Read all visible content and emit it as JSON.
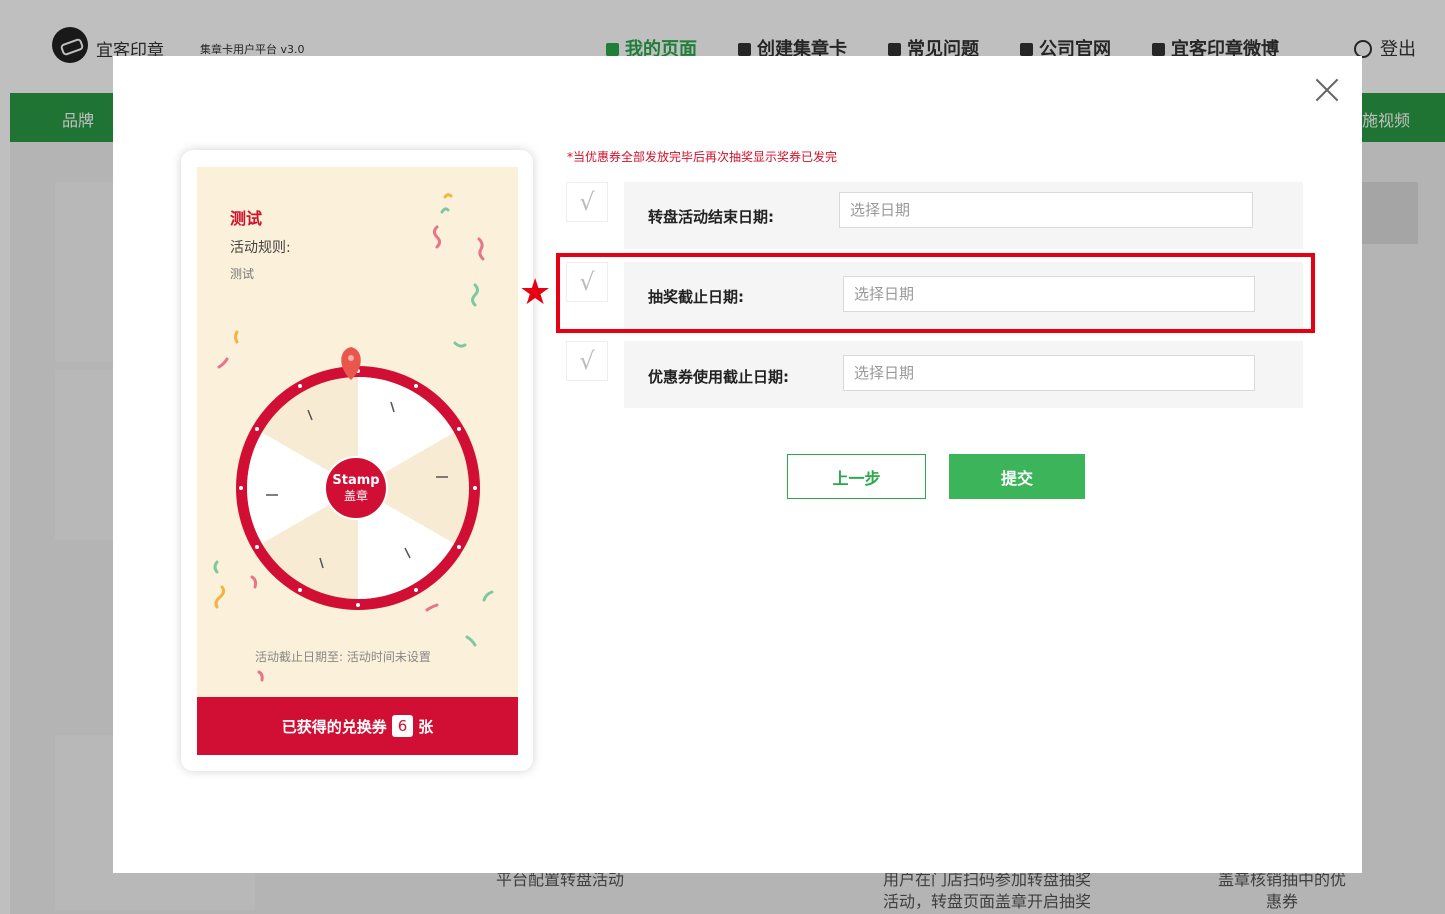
{
  "header": {
    "brand": "宜客印章",
    "subtitle": "集章卡用户平台 v3.0",
    "nav": [
      {
        "label": "我的页面"
      },
      {
        "label": "创建集章卡"
      },
      {
        "label": "常见问题"
      },
      {
        "label": "公司官网"
      },
      {
        "label": "宜客印章微博"
      }
    ],
    "logout": "登出"
  },
  "green_bar": {
    "left_text": "品牌",
    "right_text": "施视频"
  },
  "background_steps": [
    {
      "text": "平台配置转盘活动"
    },
    {
      "text_line1": "用户在门店扫码参加转盘抽奖",
      "text_line2": "活动，转盘页面盖章开启抽奖"
    },
    {
      "text_line1": "盖章核销抽中的优",
      "text_line2": "惠券"
    }
  ],
  "preview": {
    "title": "测试",
    "rules_label": "活动规则:",
    "rules_text": "测试",
    "center_top": "Stamp",
    "center_bottom": "盖章",
    "end_date_text": "活动截止日期至: 活动时间未设置",
    "coupon_prefix": "已获得的兑换券",
    "coupon_count": "6",
    "coupon_suffix": "张"
  },
  "form": {
    "warning": "*当优惠券全部发放完毕后再次抽奖显示奖券已发完",
    "fields": [
      {
        "label": "转盘活动结束日期:",
        "placeholder": "选择日期"
      },
      {
        "label": "抽奖截止日期:",
        "placeholder": "选择日期"
      },
      {
        "label": "优惠券使用截止日期:",
        "placeholder": "选择日期"
      }
    ],
    "check_glyph": "√",
    "prev_button": "上一步",
    "submit_button": "提交"
  },
  "annotation": {
    "star": "★"
  },
  "colors": {
    "accent_green": "#2aa84a",
    "accent_red": "#d0112b",
    "highlight_red": "#e60012"
  }
}
